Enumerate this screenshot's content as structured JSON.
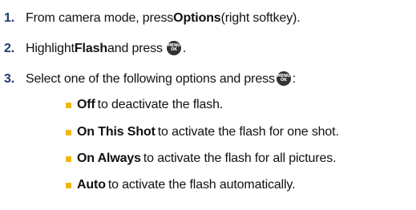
{
  "steps": [
    {
      "number": "1.",
      "pre": "From camera mode, press ",
      "bold": "Options",
      "post": "(right softkey)."
    },
    {
      "number": "2.",
      "pre": "Highlight ",
      "bold": "Flash",
      "mid": " and press ",
      "post": "."
    },
    {
      "number": "3.",
      "pre": "Select one of the following options and press ",
      "post": ":"
    }
  ],
  "menu_key": {
    "icon": "menu-ok-key-icon",
    "line1": "MENU",
    "line2": "OK"
  },
  "options": [
    {
      "bold": "Off",
      "text": "to deactivate the flash."
    },
    {
      "bold": "On This Shot",
      "text": "to activate the flash for one shot."
    },
    {
      "bold": "On Always",
      "text": "to activate the flash for all pictures."
    },
    {
      "bold": "Auto",
      "text": "to activate the flash automatically."
    }
  ],
  "colors": {
    "step_number": "#1f3b73",
    "bullet": "#f2b705",
    "key": "#333333"
  }
}
